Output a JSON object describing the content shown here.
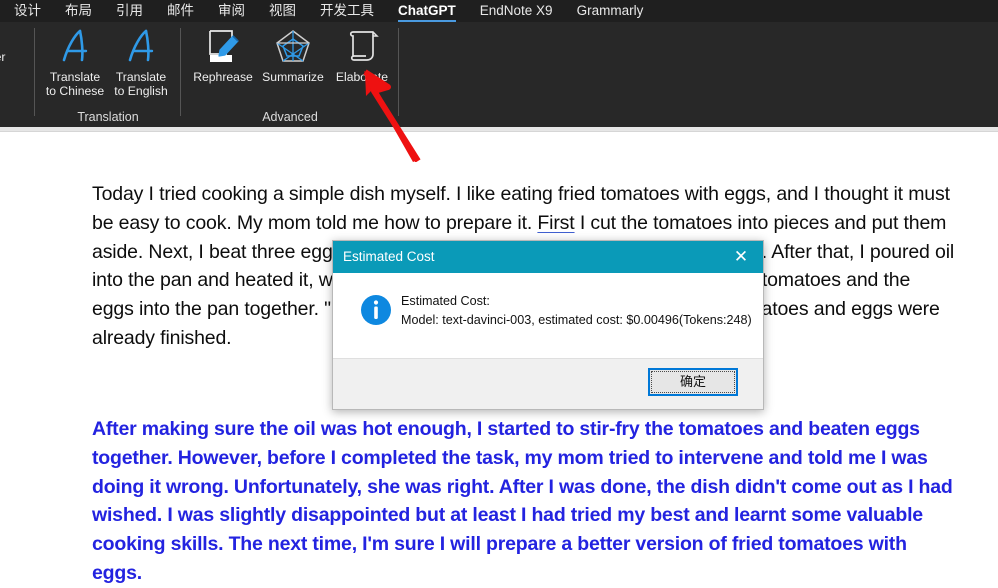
{
  "tabbar": {
    "tabs": [
      {
        "label": "设计",
        "active": false
      },
      {
        "label": "布局",
        "active": false
      },
      {
        "label": "引用",
        "active": false
      },
      {
        "label": "邮件",
        "active": false
      },
      {
        "label": "审阅",
        "active": false
      },
      {
        "label": "视图",
        "active": false
      },
      {
        "label": "开发工具",
        "active": false
      },
      {
        "label": "ChatGPT",
        "active": true
      },
      {
        "label": "EndNote X9",
        "active": false
      },
      {
        "label": "Grammarly",
        "active": false
      }
    ]
  },
  "ribbon": {
    "clipped_item": {
      "label": "mer\ns",
      "icon": "partial-icon"
    },
    "groups": [
      {
        "name": "Translation",
        "label": "Translation"
      },
      {
        "name": "Advanced",
        "label": "Advanced"
      }
    ],
    "items": [
      {
        "label": "Translate\nto Chinese",
        "icon": "letter-a-translate-icon"
      },
      {
        "label": "Translate\nto English",
        "icon": "letter-a-translate-icon"
      },
      {
        "label": "Rephrease",
        "icon": "pencil-edit-icon"
      },
      {
        "label": "Summarize",
        "icon": "pentagon-web-icon"
      },
      {
        "label": "Elaborate",
        "icon": "scroll-icon"
      }
    ]
  },
  "annotation": {
    "arrow_color": "#ee1111",
    "points_to": "Elaborate"
  },
  "document": {
    "paragraph1_pre": "Today I tried cooking a simple dish myself. I like eating fried tomatoes with eggs, and I thought it must be easy to cook. My mom told me how to prepare it. ",
    "paragraph1_marked": "First",
    "paragraph1_post": " I cut the tomatoes into pieces and put them aside. Next, I beat three eggs in a bowl and stirred them evenly with chopsticks. After that, I poured oil into the pan and heated it, waiting patiently until the oil was hot. Then, I put the tomatoes and the eggs into the pan together. \"Not like that,\" my mom tried to stop me but the tomatoes and eggs were already finished.",
    "paragraph2": "After making sure the oil was hot enough, I started to stir-fry the tomatoes and beaten eggs together. However, before I completed the task, my mom tried to intervene and told me I was doing it wrong. Unfortunately, she was right. After I was done, the dish didn't come out as I had wished. I was slightly disappointed but at least I had tried my best and learnt some valuable cooking skills. The next time, I'm sure I will prepare a better version of fried tomatoes with eggs.",
    "paragraph2_color": "#2323e0"
  },
  "dialog": {
    "title": "Estimated Cost",
    "title_bar_color": "#0a9ab8",
    "close_glyph": "✕",
    "icon": "info-icon",
    "body_line1": "Estimated Cost:",
    "body_line2": "Model: text-davinci-003, estimated cost: $0.00496(Tokens:248)",
    "ok_label": "确定"
  }
}
